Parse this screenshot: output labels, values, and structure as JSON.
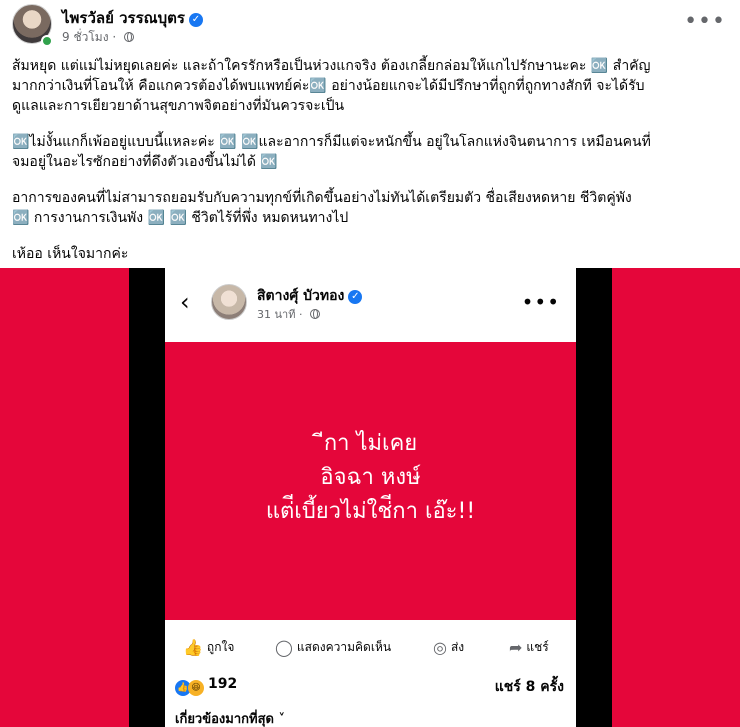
{
  "post": {
    "author": "ไพรวัลย์ วรรณบุตร",
    "time": "9 ชั่วโมง",
    "more_label": "•••",
    "paragraphs": [
      "ส้มหยุด แต่แม่ไม่หยุดเลยค่ะ และถ้าใครรักหรือเป็นห่วงแกจริง ต้องเกลี้ยกล่อมให้แกไปรักษานะคะ 🆗 สำคัญ\nมากกว่าเงินที่โอนให้ คือแกควรต้องได้พบแพทย์ค่ะ🆗 อย่างน้อยแกจะได้มีปรึกษาที่ถูกที่ถูกทางสักที จะได้รับ\nดูแลและการเยียวยาด้านสุขภาพจิตอย่างที่มันควรจะเป็น",
      "🆗ไม่งั้นแกก็เพ้ออยู่แบบนี้แหละค่ะ 🆗 🆗และอาการก็มีแต่จะหนักขึ้น อยู่ในโลกแห่งจินตนาการ เหมือนคนที่\nจมอยู่ในอะไรซักอย่างที่ดึงตัวเองขึ้นไม่ได้ 🆗",
      "อาการของคนที่ไม่สามารถยอมรับกับความทุกข์ที่เกิดขึ้นอย่างไม่ทันได้เตรียมตัว  ชื่อเสียงหดหาย  ชีวิตคู่พัง\n🆗 การงานการเงินพัง 🆗 🆗 ชีวิตไร้ที่พึ่ง หมดหนทางไป",
      "เห้ออ เห็นใจมากค่ะ"
    ]
  },
  "screenshot": {
    "author": "สิตางศุ์ บัวทอง",
    "time": "31 นาที",
    "text_lines": [
      "ีกา ไม่เคย",
      "อิจฉา หงษ์",
      "แต่ีเบี้ยวไม่ใช่ีกา เอ๊ะ!!"
    ],
    "actions": {
      "like": "ถูกใจ",
      "comment": "แสดงความคิดเห็น",
      "send": "ส่ง",
      "share": "แชร์"
    },
    "reaction_count": "192",
    "share_count": "แชร์ 8 ครั้ง",
    "sort_label": "เกี่ยวข้องมากที่สุด"
  },
  "colors": {
    "accent": "#1877f2",
    "media_red": "#e5063a",
    "online": "#31a24c"
  },
  "icons": [
    "verified-badge-icon",
    "globe-icon",
    "back-arrow-icon",
    "like-icon",
    "comment-icon",
    "messenger-icon",
    "share-icon",
    "haha-reaction-icon"
  ]
}
